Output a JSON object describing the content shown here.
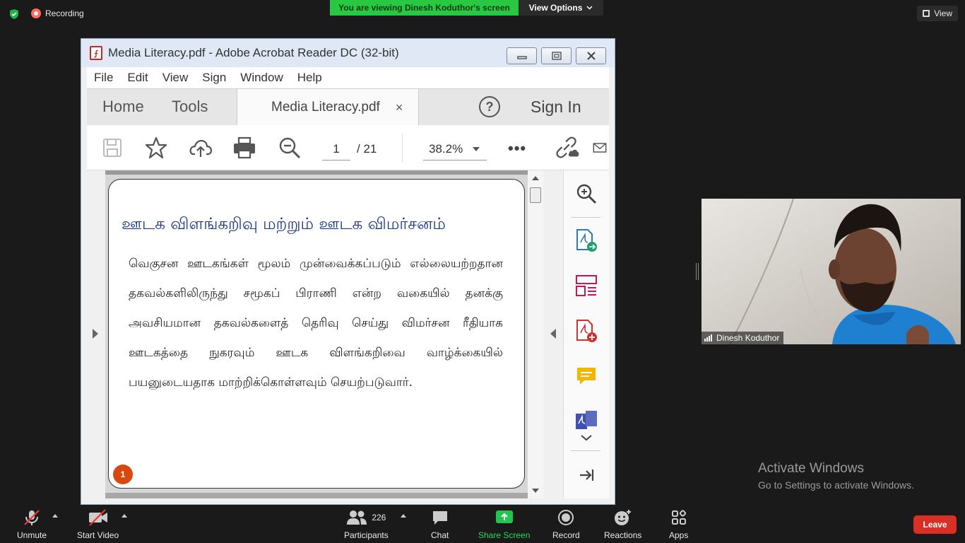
{
  "zoom": {
    "recording_label": "Recording",
    "banner": "You are viewing Dinesh Koduthor's screen",
    "view_options": "View Options",
    "view_label": "View",
    "colors": {
      "banner_green": "#28c840",
      "leave_red": "#d93025"
    }
  },
  "acrobat": {
    "title": "Media Literacy.pdf - Adobe Acrobat Reader DC (32-bit)",
    "menu": [
      "File",
      "Edit",
      "View",
      "Sign",
      "Window",
      "Help"
    ],
    "tabs": {
      "home": "Home",
      "tools": "Tools",
      "document": "Media Literacy.pdf",
      "close": "×"
    },
    "help": "?",
    "sign_in": "Sign In",
    "toolbar": {
      "page_current": "1",
      "page_total": "/ 21",
      "zoom": "38.2%",
      "more": "•••"
    },
    "page": {
      "title": "ஊடக விளங்கறிவு மற்றும் ஊடக விமர்சனம்",
      "body": "வெகுசன ஊடகங்கள் மூலம் முன்வைக்கப்படும் எல்லையற்றதான தகவல்களிலிருந்து சமூகப் பிராணி என்ற வகையில் தனக்கு அவசியமான தகவல்களைத் தெரிவு செய்து விமர்சன ரீதியாக ஊடகத்தை நுகரவும் ஊடக விளங்கறிவை வாழ்க்கையில் பயனுடையதாக மாற்றிக்கொள்ளவும் செயற்படுவார்.",
      "number": "1"
    }
  },
  "video": {
    "participant_name": "Dinesh Koduthor"
  },
  "watermark": {
    "line1": "Activate Windows",
    "line2": "Go to Settings to activate Windows."
  },
  "controls": {
    "unmute": "Unmute",
    "start_video": "Start Video",
    "participants": "Participants",
    "participant_count": "226",
    "chat": "Chat",
    "share_screen": "Share Screen",
    "record": "Record",
    "reactions": "Reactions",
    "apps": "Apps",
    "leave": "Leave"
  }
}
